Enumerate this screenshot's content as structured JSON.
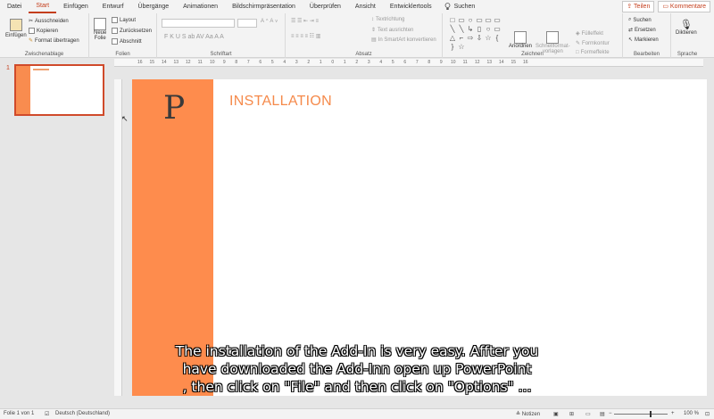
{
  "menu": {
    "tabs": [
      "Datei",
      "Start",
      "Einfügen",
      "Entwurf",
      "Übergänge",
      "Animationen",
      "Bildschirmpräsentation",
      "Überprüfen",
      "Ansicht",
      "Entwicklertools"
    ],
    "active_tab": "Start",
    "search_label": "Suchen",
    "share_label": "Teilen",
    "comments_label": "Kommentare"
  },
  "ribbon": {
    "clipboard": {
      "paste": "Einfügen",
      "cut": "Ausschneiden",
      "copy": "Kopieren",
      "format_painter": "Format übertragen",
      "label": "Zwischenablage"
    },
    "slides": {
      "new_slide_line1": "Neue",
      "new_slide_line2": "Folie",
      "layout": "Layout",
      "reset": "Zurücksetzen",
      "section": "Abschnitt",
      "label": "Folien"
    },
    "font": {
      "label": "Schriftart",
      "format_buttons": "F  K  U  S  ab  AV  Aa  A  A"
    },
    "paragraph": {
      "text_direction": "Textrichtung",
      "align_text": "Text ausrichten",
      "convert_smartart": "In SmartArt konvertieren",
      "label": "Absatz"
    },
    "drawing": {
      "arrange": "Anordnen",
      "quick_styles_line1": "Schnellformat-",
      "quick_styles_line2": "vorlagen",
      "fill": "Fülleffekt",
      "outline": "Formkontur",
      "effects": "Formeffekte",
      "label": "Zeichnen",
      "shape_glyphs": [
        "□",
        "▭",
        "○",
        "▭",
        "▭",
        "▭",
        "╲",
        "╲",
        "↳",
        "▯",
        "○",
        "▭",
        "△",
        "⌐",
        "⇨",
        "⇩",
        "☆",
        "{",
        "}",
        "☆",
        "",
        "",
        "",
        ""
      ]
    },
    "editing": {
      "find": "Suchen",
      "replace": "Ersetzen",
      "select": "Markieren",
      "label": "Bearbeiten"
    },
    "voice": {
      "dictate": "Diktieren",
      "label": "Sprache"
    }
  },
  "ruler": {
    "h_ticks": [
      "16",
      "15",
      "14",
      "13",
      "12",
      "11",
      "10",
      "9",
      "8",
      "7",
      "6",
      "5",
      "4",
      "3",
      "2",
      "1",
      "0",
      "1",
      "2",
      "3",
      "4",
      "5",
      "6",
      "7",
      "8",
      "9",
      "10",
      "11",
      "12",
      "13",
      "14",
      "15",
      "16"
    ]
  },
  "thumbnails": {
    "slide_number": "1"
  },
  "slide": {
    "logo_letter": "P",
    "title": "INSTALLATION"
  },
  "caption": {
    "line1": "The installation of the Add-In is very easy. Affter you",
    "line2": "have downloaded the Add-Inn open up PowerPoint",
    "line3": ", then click on \"File\" and then click on \"Options\" ..."
  },
  "status": {
    "slide_info": "Folie 1 von 1",
    "language": "Deutsch (Deutschland)",
    "notes": "Notizen",
    "zoom": "100 %"
  },
  "colors": {
    "accent": "#c43e1c",
    "slide_band": "#fe8c4d",
    "slide_title": "#f58a4b"
  }
}
